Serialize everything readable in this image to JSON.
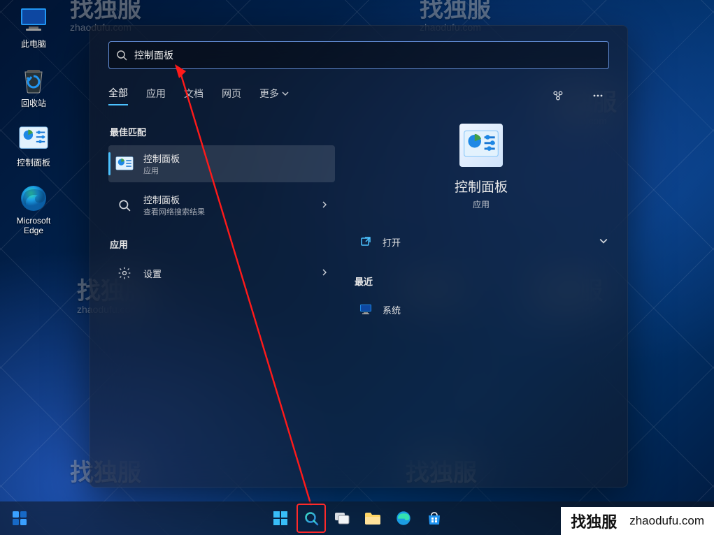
{
  "desktop_icons": [
    {
      "name": "this-pc",
      "label": "此电脑"
    },
    {
      "name": "recycle-bin",
      "label": "回收站"
    },
    {
      "name": "control-panel",
      "label": "控制面板"
    },
    {
      "name": "edge",
      "label": "Microsoft Edge"
    }
  ],
  "search": {
    "query": "控制面板",
    "tabs": {
      "all": "全部",
      "apps": "应用",
      "docs": "文档",
      "web": "网页",
      "more": "更多"
    },
    "sections": {
      "best": "最佳匹配",
      "apps": "应用",
      "recent": "最近"
    },
    "best_match": {
      "title": "控制面板",
      "subtitle": "应用"
    },
    "web_result": {
      "title": "控制面板",
      "subtitle": "查看网络搜索结果"
    },
    "apps_result": {
      "title": "设置"
    },
    "preview": {
      "title": "控制面板",
      "subtitle": "应用"
    },
    "actions": {
      "open": "打开",
      "recent_item": "系统"
    }
  },
  "watermark": {
    "big": "找独服",
    "small": "zhaodufu.com"
  }
}
